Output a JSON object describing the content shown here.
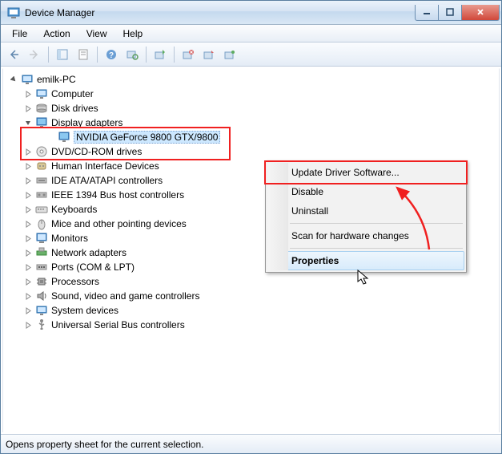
{
  "window": {
    "title": "Device Manager"
  },
  "menu": {
    "file": "File",
    "action": "Action",
    "view": "View",
    "help": "Help"
  },
  "tree": {
    "root": "emilk-PC",
    "nodes": [
      {
        "label": "Computer",
        "icon": "computer"
      },
      {
        "label": "Disk drives",
        "icon": "disk"
      },
      {
        "label": "Display adapters",
        "icon": "display",
        "expanded": true,
        "children": [
          {
            "label": "NVIDIA GeForce 9800 GTX/9800",
            "icon": "display",
            "selected": true
          }
        ]
      },
      {
        "label": "DVD/CD-ROM drives",
        "icon": "dvd"
      },
      {
        "label": "Human Interface Devices",
        "icon": "hid"
      },
      {
        "label": "IDE ATA/ATAPI controllers",
        "icon": "ide"
      },
      {
        "label": "IEEE 1394 Bus host controllers",
        "icon": "ieee"
      },
      {
        "label": "Keyboards",
        "icon": "keyboard"
      },
      {
        "label": "Mice and other pointing devices",
        "icon": "mouse"
      },
      {
        "label": "Monitors",
        "icon": "monitor"
      },
      {
        "label": "Network adapters",
        "icon": "network"
      },
      {
        "label": "Ports (COM & LPT)",
        "icon": "port"
      },
      {
        "label": "Processors",
        "icon": "cpu"
      },
      {
        "label": "Sound, video and game controllers",
        "icon": "sound"
      },
      {
        "label": "System devices",
        "icon": "system"
      },
      {
        "label": "Universal Serial Bus controllers",
        "icon": "usb"
      }
    ]
  },
  "contextMenu": {
    "update": "Update Driver Software...",
    "disable": "Disable",
    "uninstall": "Uninstall",
    "scan": "Scan for hardware changes",
    "properties": "Properties"
  },
  "statusbar": "Opens property sheet for the current selection."
}
